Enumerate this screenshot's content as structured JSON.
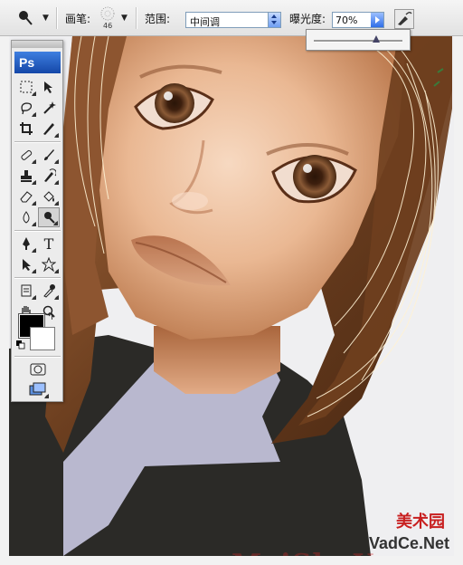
{
  "options_bar": {
    "tool_icon": "dodge-tool-icon",
    "brush_label": "画笔:",
    "brush_size": "46",
    "range_label": "范围:",
    "range_value": "中间调",
    "exposure_label": "曝光度:",
    "exposure_value": "70%",
    "exposure_fraction": 0.7,
    "airbrush_icon": "airbrush-icon"
  },
  "toolbox": {
    "logo": "Ps",
    "tools": [
      "marquee-tool",
      "move-tool",
      "lasso-tool",
      "magic-wand-tool",
      "crop-tool",
      "slice-tool",
      "healing-brush-tool",
      "brush-tool",
      "clone-stamp-tool",
      "history-brush-tool",
      "eraser-tool",
      "paint-bucket-tool",
      "blur-tool",
      "dodge-tool",
      "pen-tool",
      "type-tool",
      "path-selection-tool",
      "custom-shape-tool",
      "notes-tool",
      "eyedropper-tool",
      "hand-tool",
      "zoom-tool"
    ],
    "type_tool_glyph": "T",
    "foreground_color": "#000000",
    "background_color": "#ffffff"
  },
  "colors": {
    "hair": "#6b3e1f",
    "skin": "#e9b28c",
    "shirt": "#2a2a28",
    "collar": "#b9b8cf",
    "watermark": "#c81f1f"
  },
  "watermark": {
    "site_latin": "MeiShuYuan.com",
    "site_cn": "美术园",
    "sub": "VadCe.Net"
  }
}
